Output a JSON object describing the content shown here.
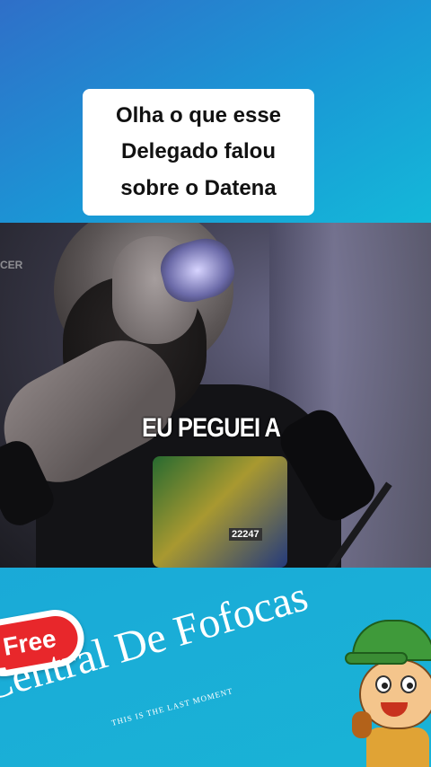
{
  "caption": {
    "lines": [
      "Olha o que esse",
      "Delegado falou",
      "sobre o Datena"
    ]
  },
  "video": {
    "subtitle": "EU PEGUEI A",
    "shirt_number": "22247",
    "watermark_left": "CER"
  },
  "branding": {
    "badge": "Free",
    "name": "Central De Fofocas",
    "tagline": "THIS IS THE LAST MOMENT"
  },
  "colors": {
    "caption_bg": "#ffffff",
    "badge_red": "#e8272b",
    "mascot_cap": "#3f9a3a"
  },
  "icons": {
    "mascot": "cartoon-character-icon"
  }
}
